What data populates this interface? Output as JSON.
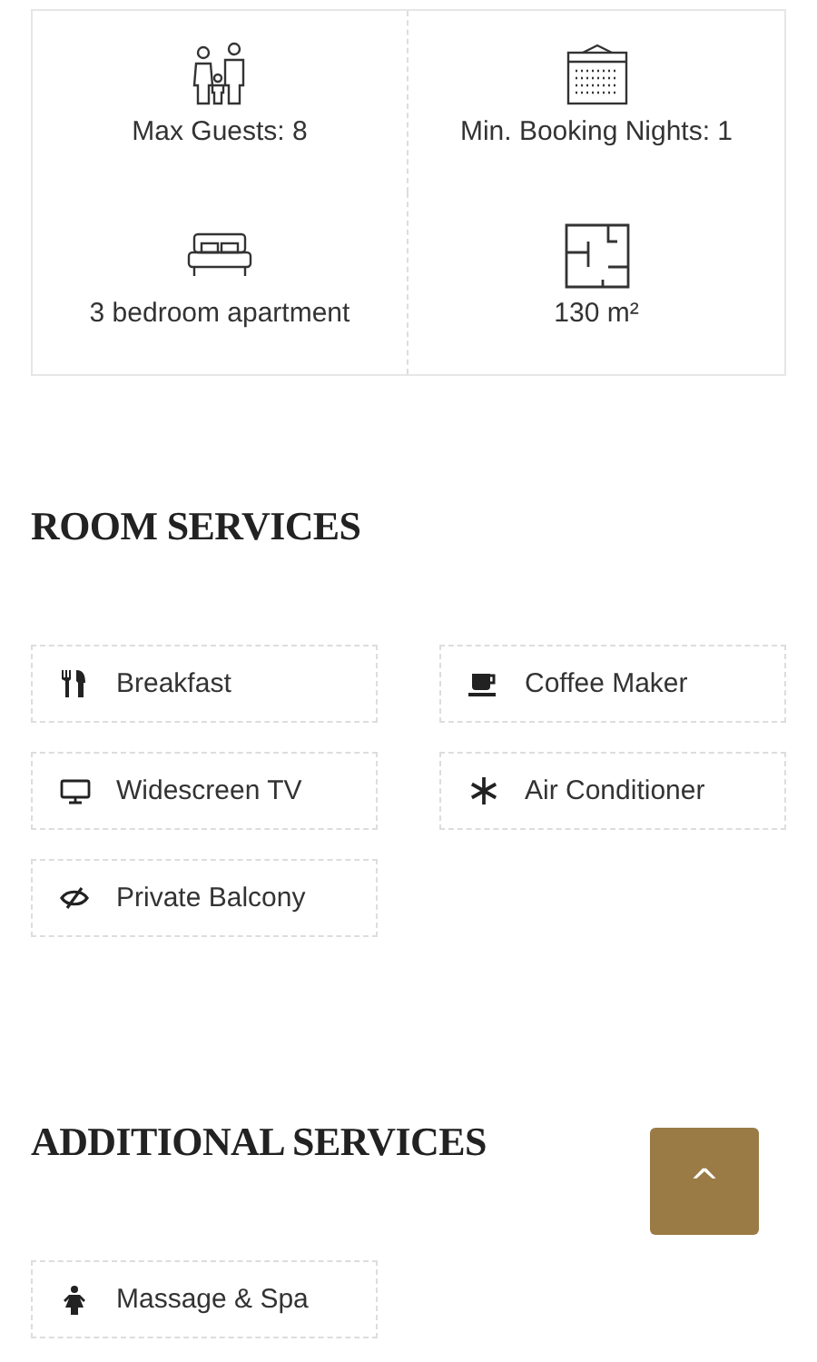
{
  "facts": [
    {
      "kind": "guests",
      "label": "Max Guests: 8"
    },
    {
      "kind": "calendar",
      "label": "Min. Booking Nights: 1"
    },
    {
      "kind": "bed",
      "label": "3 bedroom apartment"
    },
    {
      "kind": "floorplan",
      "label": "130 m²"
    }
  ],
  "sections": [
    {
      "title": "ROOM SERVICES",
      "items": [
        {
          "kind": "breakfast",
          "label": "Breakfast"
        },
        {
          "kind": "coffee",
          "label": "Coffee Maker"
        },
        {
          "kind": "tv",
          "label": "Widescreen TV"
        },
        {
          "kind": "snowflake",
          "label": "Air Conditioner"
        },
        {
          "kind": "balcony",
          "label": "Private Balcony"
        }
      ]
    },
    {
      "title": "ADDITIONAL SERVICES",
      "items": [
        {
          "kind": "spa",
          "label": "Massage & Spa"
        }
      ]
    }
  ],
  "back_to_top": {
    "icon": "^"
  }
}
